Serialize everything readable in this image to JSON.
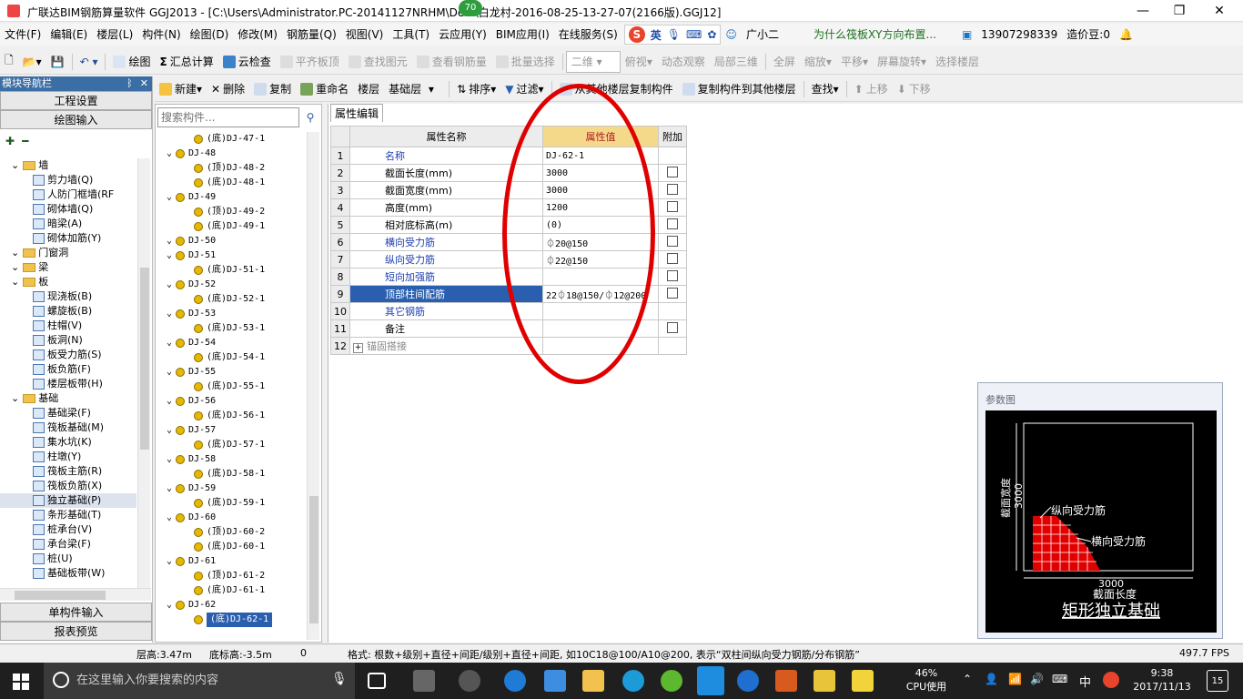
{
  "titlebar": {
    "title": "广联达BIM钢筋算量软件 GGJ2013 - [C:\\Users\\Administrator.PC-20141127NRHM\\De...\\白龙村-2016-08-25-13-27-07(2166版).GGJ12]",
    "badge": "70",
    "minimize": "—",
    "restore": "❐",
    "close": "✕"
  },
  "menubar": {
    "items": [
      "文件(F)",
      "编辑(E)",
      "楼层(L)",
      "构件(N)",
      "绘图(D)",
      "修改(M)",
      "钢筋量(Q)",
      "视图(V)",
      "工具(T)",
      "云应用(Y)",
      "BIM应用(I)",
      "在线服务(S)"
    ],
    "ime": "英",
    "right_items": [
      "广小二",
      "为什么筏板XY方向布置...",
      "13907298339",
      "造价豆:0"
    ]
  },
  "toolbar1": {
    "draw": "绘图",
    "sum": "汇总计算",
    "cloud": "云检查",
    "flat": "平齐板顶",
    "find": "查找图元",
    "view_rebar": "查看钢筋量",
    "batch": "批量选择",
    "dim": "二维",
    "top": "俯视",
    "dyn": "动态观察",
    "local3d": "局部三维",
    "full": "全屏",
    "zoom": "缩放",
    "pan": "平移",
    "rotate": "屏幕旋转",
    "pick_floor": "选择楼层"
  },
  "toolbar2": {
    "new": "新建",
    "delete": "删除",
    "copy": "复制",
    "rename": "重命名",
    "floor_label": "楼层",
    "floor": "基础层",
    "sort": "排序",
    "filter": "过滤",
    "copy_from": "从其他楼层复制构件",
    "copy_to": "复制构件到其他楼层",
    "find": "查找",
    "up": "上移",
    "down": "下移"
  },
  "nav": {
    "header": "模块导航栏",
    "pin": "ᛒ",
    "close": "✕",
    "settings": "工程设置",
    "draw_input": "绘图输入",
    "single_input": "单构件输入",
    "report": "报表预览",
    "tree": [
      {
        "t": "墙",
        "lvl": 0,
        "fold": true
      },
      {
        "t": "剪力墙(Q)",
        "lvl": 1
      },
      {
        "t": "人防门框墙(RF",
        "lvl": 1
      },
      {
        "t": "砌体墙(Q)",
        "lvl": 1
      },
      {
        "t": "暗梁(A)",
        "lvl": 1
      },
      {
        "t": "砌体加筋(Y)",
        "lvl": 1
      },
      {
        "t": "门窗洞",
        "lvl": 0,
        "fold": true
      },
      {
        "t": "梁",
        "lvl": 0,
        "fold": true
      },
      {
        "t": "板",
        "lvl": 0,
        "fold": true
      },
      {
        "t": "现浇板(B)",
        "lvl": 1
      },
      {
        "t": "螺旋板(B)",
        "lvl": 1
      },
      {
        "t": "柱帽(V)",
        "lvl": 1
      },
      {
        "t": "板洞(N)",
        "lvl": 1
      },
      {
        "t": "板受力筋(S)",
        "lvl": 1
      },
      {
        "t": "板负筋(F)",
        "lvl": 1
      },
      {
        "t": "楼层板带(H)",
        "lvl": 1
      },
      {
        "t": "基础",
        "lvl": 0,
        "fold": true
      },
      {
        "t": "基础梁(F)",
        "lvl": 1
      },
      {
        "t": "筏板基础(M)",
        "lvl": 1
      },
      {
        "t": "集水坑(K)",
        "lvl": 1
      },
      {
        "t": "柱墩(Y)",
        "lvl": 1
      },
      {
        "t": "筏板主筋(R)",
        "lvl": 1
      },
      {
        "t": "筏板负筋(X)",
        "lvl": 1
      },
      {
        "t": "独立基础(P)",
        "lvl": 1
      },
      {
        "t": "条形基础(T)",
        "lvl": 1
      },
      {
        "t": "桩承台(V)",
        "lvl": 1
      },
      {
        "t": "承台梁(F)",
        "lvl": 1
      },
      {
        "t": "桩(U)",
        "lvl": 1
      },
      {
        "t": "基础板带(W)",
        "lvl": 1
      }
    ]
  },
  "components": {
    "search_placeholder": "搜索构件...",
    "items": [
      {
        "t": "(底)DJ-47-1",
        "lvl": 1
      },
      {
        "t": "DJ-48",
        "lvl": 0
      },
      {
        "t": "(顶)DJ-48-2",
        "lvl": 1
      },
      {
        "t": "(底)DJ-48-1",
        "lvl": 1
      },
      {
        "t": "DJ-49",
        "lvl": 0
      },
      {
        "t": "(顶)DJ-49-2",
        "lvl": 1
      },
      {
        "t": "(底)DJ-49-1",
        "lvl": 1
      },
      {
        "t": "DJ-50",
        "lvl": 0
      },
      {
        "t": "DJ-51",
        "lvl": 0
      },
      {
        "t": "(底)DJ-51-1",
        "lvl": 1
      },
      {
        "t": "DJ-52",
        "lvl": 0
      },
      {
        "t": "(底)DJ-52-1",
        "lvl": 1
      },
      {
        "t": "DJ-53",
        "lvl": 0
      },
      {
        "t": "(底)DJ-53-1",
        "lvl": 1
      },
      {
        "t": "DJ-54",
        "lvl": 0
      },
      {
        "t": "(底)DJ-54-1",
        "lvl": 1
      },
      {
        "t": "DJ-55",
        "lvl": 0
      },
      {
        "t": "(底)DJ-55-1",
        "lvl": 1
      },
      {
        "t": "DJ-56",
        "lvl": 0
      },
      {
        "t": "(底)DJ-56-1",
        "lvl": 1
      },
      {
        "t": "DJ-57",
        "lvl": 0
      },
      {
        "t": "(底)DJ-57-1",
        "lvl": 1
      },
      {
        "t": "DJ-58",
        "lvl": 0
      },
      {
        "t": "(底)DJ-58-1",
        "lvl": 1
      },
      {
        "t": "DJ-59",
        "lvl": 0
      },
      {
        "t": "(底)DJ-59-1",
        "lvl": 1
      },
      {
        "t": "DJ-60",
        "lvl": 0
      },
      {
        "t": "(顶)DJ-60-2",
        "lvl": 1
      },
      {
        "t": "(底)DJ-60-1",
        "lvl": 1
      },
      {
        "t": "DJ-61",
        "lvl": 0
      },
      {
        "t": "(顶)DJ-61-2",
        "lvl": 1
      },
      {
        "t": "(底)DJ-61-1",
        "lvl": 1
      },
      {
        "t": "DJ-62",
        "lvl": 0
      },
      {
        "t": "(底)DJ-62-1",
        "lvl": 1,
        "sel": true
      }
    ]
  },
  "props": {
    "tab": "属性编辑",
    "col_name": "属性名称",
    "col_value": "属性值",
    "col_add": "附加",
    "rows": [
      {
        "n": "1",
        "name": "名称",
        "value": "DJ-62-1",
        "blue": true,
        "cb": false
      },
      {
        "n": "2",
        "name": "截面长度(mm)",
        "value": "3000",
        "cb": true
      },
      {
        "n": "3",
        "name": "截面宽度(mm)",
        "value": "3000",
        "cb": true
      },
      {
        "n": "4",
        "name": "高度(mm)",
        "value": "1200",
        "cb": true
      },
      {
        "n": "5",
        "name": "相对底标高(m)",
        "value": "(0)",
        "cb": true
      },
      {
        "n": "6",
        "name": "横向受力筋",
        "value": "⏀20@150",
        "blue": true,
        "cb": true
      },
      {
        "n": "7",
        "name": "纵向受力筋",
        "value": "⏀22@150",
        "blue": true,
        "cb": true
      },
      {
        "n": "8",
        "name": "短向加强筋",
        "value": "",
        "blue": true,
        "cb": true
      },
      {
        "n": "9",
        "name": "顶部柱间配筋",
        "value": "22⏀18@150/⏀12@200",
        "blue": true,
        "cb": true,
        "sel": true
      },
      {
        "n": "10",
        "name": "其它钢筋",
        "value": "",
        "blue": true,
        "cb": false
      },
      {
        "n": "11",
        "name": "备注",
        "value": "",
        "cb": true
      },
      {
        "n": "12",
        "name": "锚固搭接",
        "value": "",
        "gray": true,
        "cb": false,
        "expand": "+"
      }
    ]
  },
  "param": {
    "title": "参数图",
    "width_label": "截面宽度",
    "width_val": "3000",
    "length_label": "截面长度",
    "length_val": "3000",
    "long_rebar": "纵向受力筋",
    "trans_rebar": "横向受力筋",
    "caption": "矩形独立基础"
  },
  "status": {
    "floor_h": "层高:3.47m",
    "base_h": "底标高:-3.5m",
    "zero": "0",
    "hint": "格式: 根数+级别+直径+间距/级别+直径+间距, 如10C18@100/A10@200, 表示“双柱间纵向受力钢筋/分布钢筋”",
    "fps": "497.7 FPS"
  },
  "taskbar": {
    "search": "在这里输入你要搜索的内容",
    "cpu_pct": "46%",
    "cpu_label": "CPU使用",
    "ime": "中",
    "time": "9:38",
    "date": "2017/11/13",
    "notif": "15"
  }
}
